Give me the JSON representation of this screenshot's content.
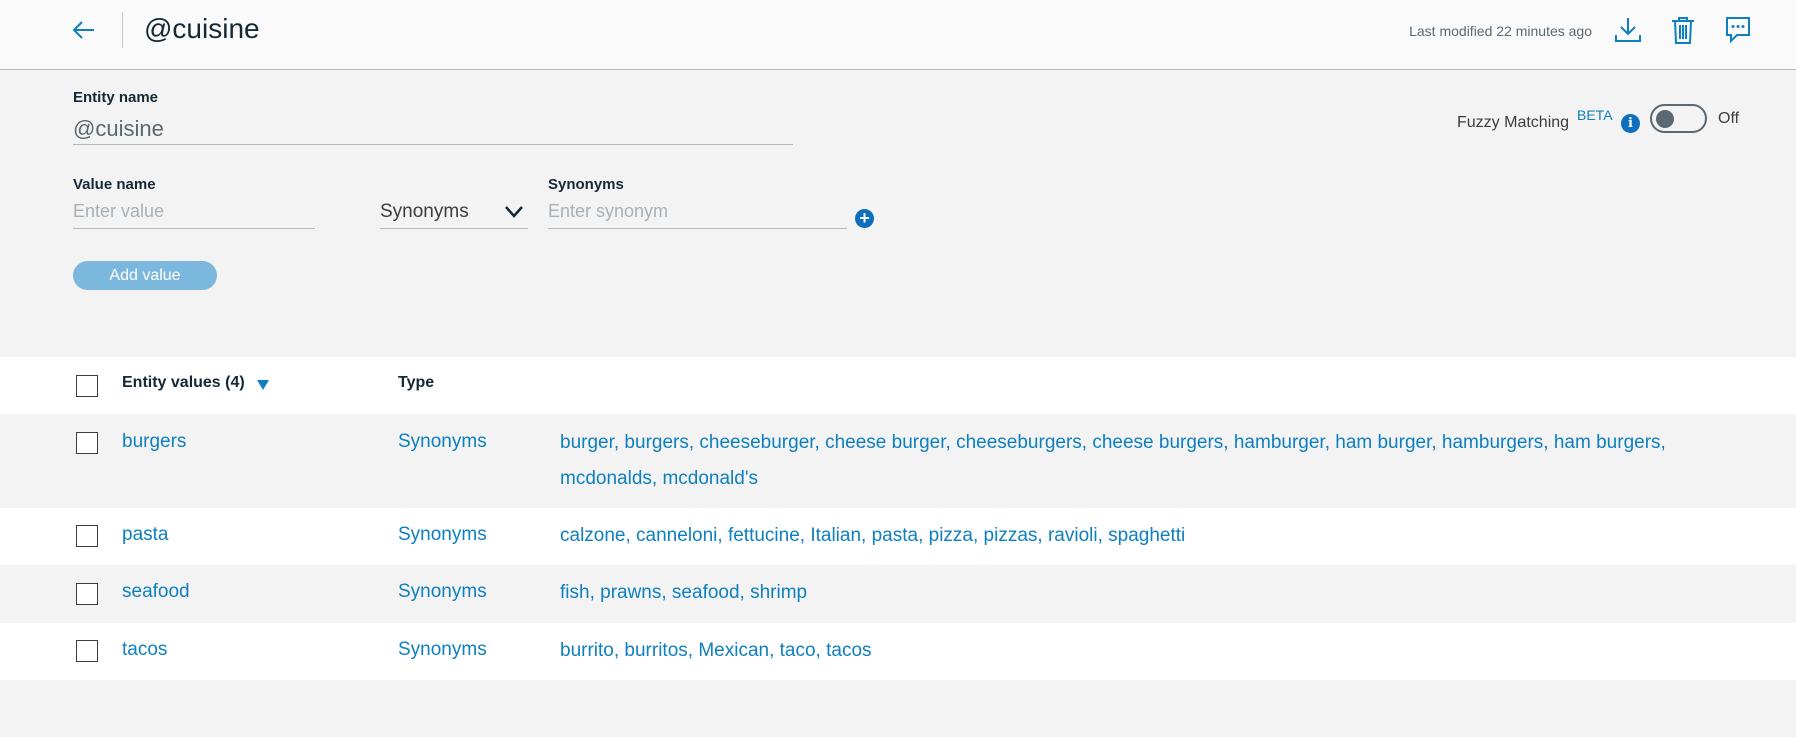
{
  "header": {
    "title": "@cuisine",
    "last_modified": "Last modified 22 minutes ago",
    "icons": [
      "back-arrow-icon",
      "download-icon",
      "trash-icon",
      "chat-icon"
    ]
  },
  "form": {
    "entity_name_label": "Entity name",
    "entity_name_value": "@cuisine",
    "fuzzy_label": "Fuzzy Matching",
    "fuzzy_badge": "BETA",
    "info_glyph": "i",
    "fuzzy_state": "Off",
    "value_name_label": "Value name",
    "value_placeholder": "Enter value",
    "type_selected": "Synonyms",
    "synonyms_label": "Synonyms",
    "synonym_placeholder": "Enter synonym",
    "add_glyph": "+",
    "add_value_button": "Add value"
  },
  "table": {
    "col_values": "Entity values (4)",
    "col_type": "Type",
    "rows": [
      {
        "name": "burgers",
        "type": "Synonyms",
        "synonyms": "burger, burgers, cheeseburger, cheese burger, cheeseburgers, cheese burgers, hamburger, ham burger, hamburgers, ham burgers, mcdonalds, mcdonald's"
      },
      {
        "name": "pasta",
        "type": "Synonyms",
        "synonyms": "calzone, canneloni, fettucine, Italian, pasta, pizza, pizzas, ravioli, spaghetti"
      },
      {
        "name": "seafood",
        "type": "Synonyms",
        "synonyms": "fish, prawns, seafood, shrimp"
      },
      {
        "name": "tacos",
        "type": "Synonyms",
        "synonyms": "burrito, burritos, Mexican, taco, tacos"
      }
    ]
  },
  "colors": {
    "accent": "#0e7fbf",
    "button_disabled": "#7cb8de",
    "page_bg": "#f3f3f3"
  }
}
